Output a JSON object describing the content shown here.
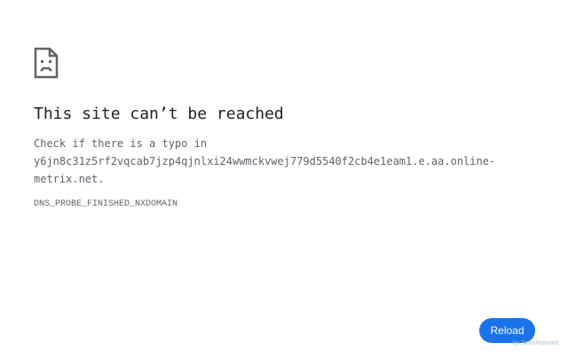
{
  "error": {
    "icon": "sad-page-icon",
    "title": "This site can’t be reached",
    "message_prefix": "Check if there is a typo in",
    "domain": "y6jn8c31z5rf2vqcab7jzp4qjnlxi24wwmckvwej779d5540f2cb4e1eam1.e.aa.online-metrix.net.",
    "code": "DNS_PROBE_FINISHED_NXDOMAIN"
  },
  "actions": {
    "reload_label": "Reload"
  },
  "watermark": {
    "text": "by ScanMalware"
  },
  "colors": {
    "accent": "#1a73e8",
    "title": "#202124",
    "body_text": "#5f6368"
  }
}
